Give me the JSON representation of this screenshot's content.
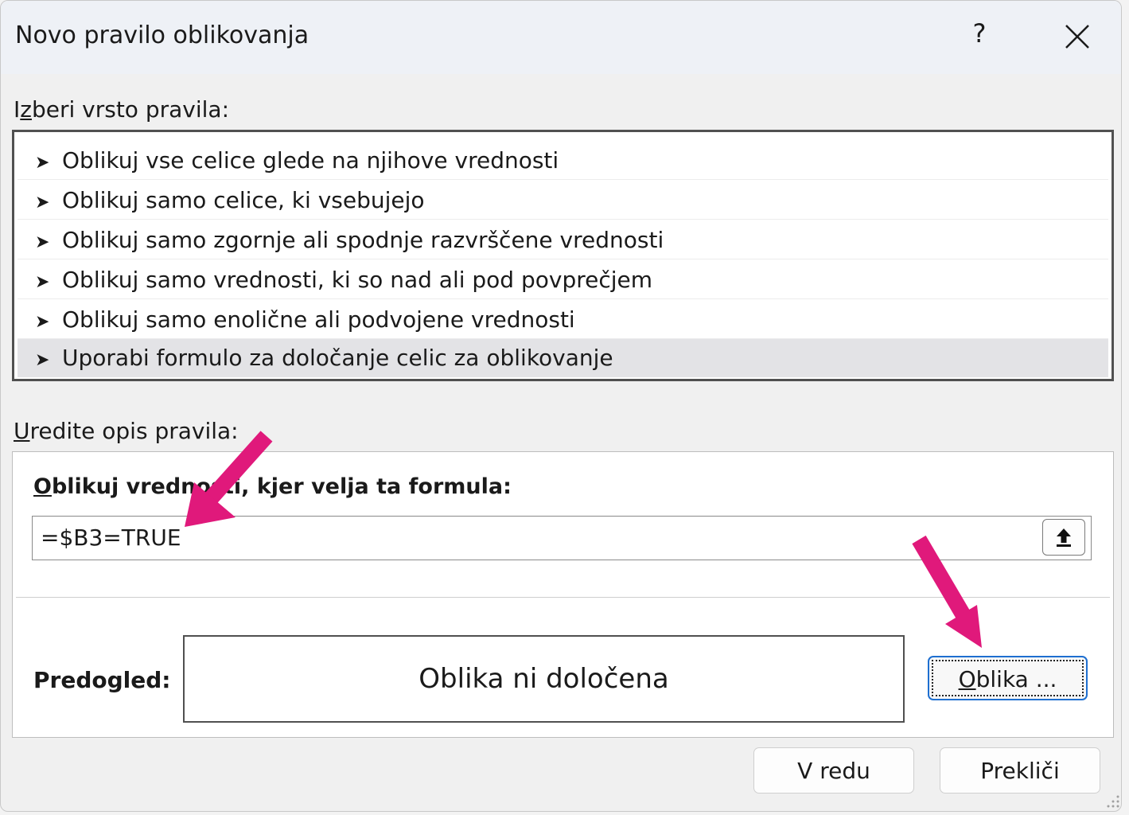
{
  "window": {
    "title": "Novo pravilo oblikovanja",
    "help_label": "?"
  },
  "rule_type": {
    "label_prefix": "I",
    "label_mnemonic": "z",
    "label_rest": "beri vrsto pravila:",
    "items": [
      {
        "label": "Oblikuj vse celice glede na njihove vrednosti"
      },
      {
        "label": "Oblikuj samo celice, ki vsebujejo"
      },
      {
        "label": "Oblikuj samo zgornje ali spodnje razvrščene vrednosti"
      },
      {
        "label": "Oblikuj samo vrednosti, ki so nad ali pod povprečjem"
      },
      {
        "label": "Oblikuj samo enolične ali podvojene vrednosti"
      },
      {
        "label": "Uporabi formulo za določanje celic za oblikovanje",
        "selected": true
      }
    ],
    "bullet": "➤"
  },
  "description": {
    "label_mnemonic": "U",
    "label_rest": "redite opis pravila:",
    "formula_label_mnemonic": "O",
    "formula_label_rest": "blikuj vrednosti, kjer velja ta formula:",
    "formula_value": "=$B3=TRUE",
    "preview_label": "Predogled:",
    "preview_text": "Oblika ni določena",
    "format_button_mnemonic": "O",
    "format_button_rest": "blika ..."
  },
  "buttons": {
    "ok": "V redu",
    "cancel": "Prekliči"
  },
  "colors": {
    "accent": "#1e6fd0",
    "annotation_arrow": "#e0197b"
  }
}
